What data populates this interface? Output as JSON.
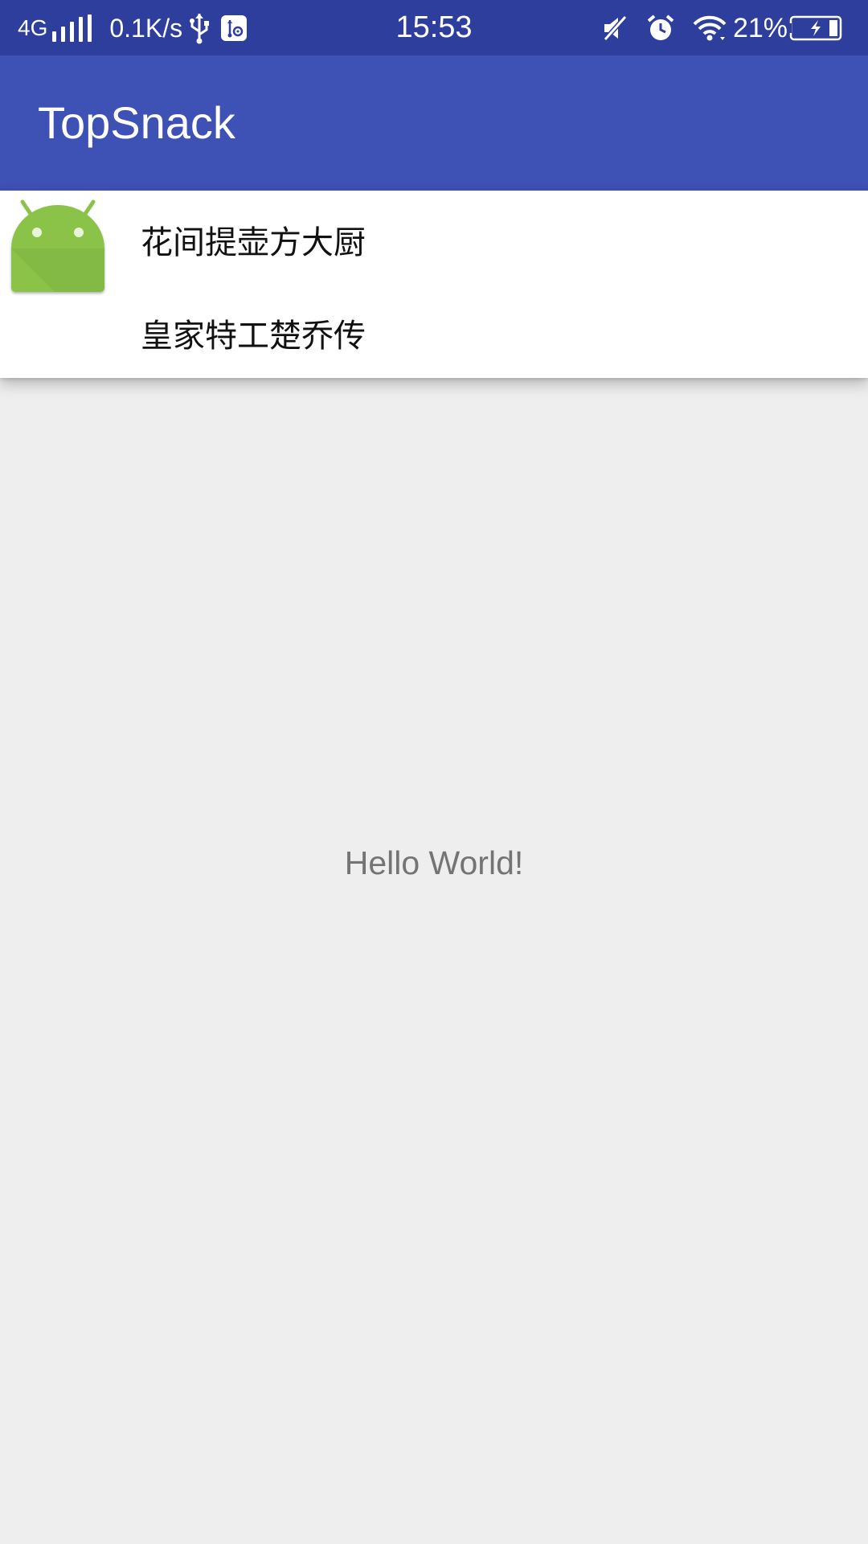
{
  "status_bar": {
    "network_type": "4G",
    "net_speed": "0.1K/s",
    "time": "15:53",
    "battery_percent": "21%",
    "icons": [
      "signal-icon",
      "usb-icon",
      "usb-debug-icon",
      "mute-icon",
      "alarm-icon",
      "wifi-icon",
      "battery-charging-icon"
    ]
  },
  "app_bar": {
    "title": "TopSnack"
  },
  "list": {
    "items": [
      {
        "label": "花间提壶方大厨"
      },
      {
        "label": "皇家特工楚乔传"
      }
    ]
  },
  "main": {
    "hello_text": "Hello World!"
  },
  "colors": {
    "status_bar": "#2D3E9C",
    "app_bar": "#3E51B5",
    "android_green": "#8BC34A",
    "background": "#EEEEEE"
  }
}
